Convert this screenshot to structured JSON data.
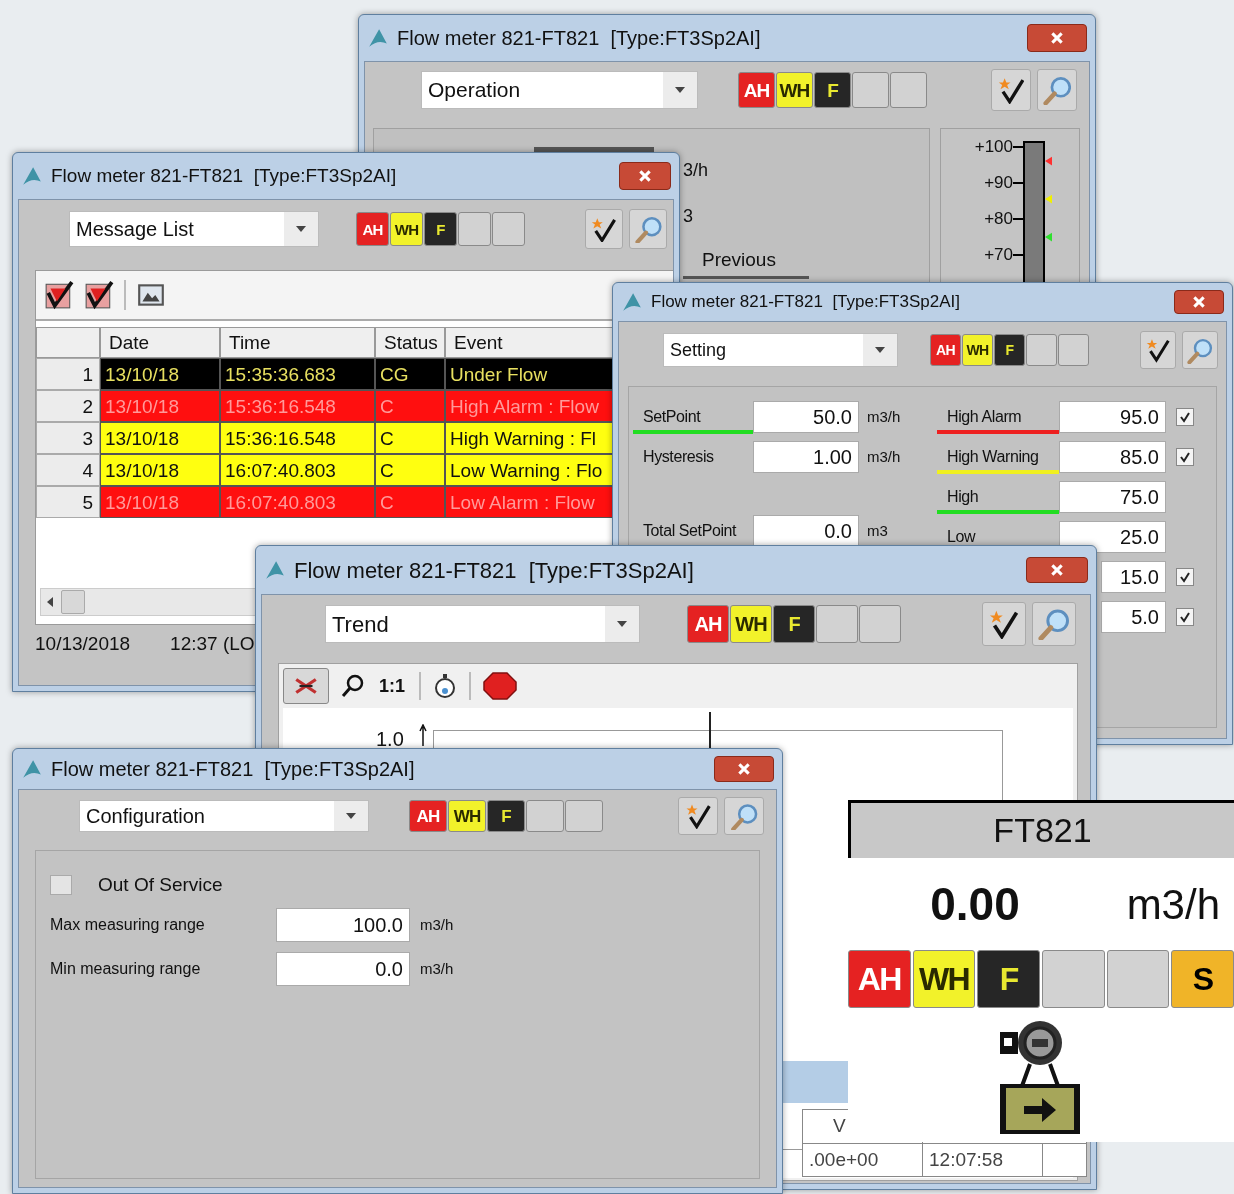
{
  "operation_window": {
    "title": "Flow meter 821-FT821  [Type:FT3Sp2AI]",
    "view": "Operation",
    "indicators": [
      {
        "kind": "alarm",
        "label": "AH"
      },
      {
        "kind": "warning",
        "label": "WH"
      },
      {
        "kind": "fault",
        "label": "F"
      },
      {
        "kind": "blank"
      },
      {
        "kind": "blank"
      }
    ],
    "fragments": [
      "3/h",
      "3"
    ],
    "tab": "Previous",
    "gauge": {
      "ticks": [
        "+100",
        "+90",
        "+80",
        "+70"
      ],
      "markers": [
        {
          "color": "#ff3030"
        },
        {
          "color": "#f0f000"
        },
        {
          "color": "#30e030"
        }
      ]
    }
  },
  "message_list_window": {
    "title": "Flow meter 821-FT821  [Type:FT3Sp2AI]",
    "view": "Message List",
    "indicators": [
      {
        "kind": "alarm",
        "label": "AH"
      },
      {
        "kind": "warning",
        "label": "WH"
      },
      {
        "kind": "fault",
        "label": "F"
      },
      {
        "kind": "blank"
      },
      {
        "kind": "blank"
      }
    ],
    "table": {
      "columns": [
        "Date",
        "Time",
        "Status",
        "Event"
      ],
      "rows": [
        {
          "number": "1",
          "kind": "normal",
          "cells": [
            "13/10/18",
            "15:35:36.683",
            "CG",
            "Under Flow"
          ]
        },
        {
          "number": "2",
          "kind": "alarm",
          "cells": [
            "13/10/18",
            "15:36:16.548",
            "C",
            "High Alarm : Flow"
          ]
        },
        {
          "number": "3",
          "kind": "warning",
          "cells": [
            "13/10/18",
            "15:36:16.548",
            "C",
            "High Warning : Fl"
          ]
        },
        {
          "number": "4",
          "kind": "warning",
          "cells": [
            "13/10/18",
            "16:07:40.803",
            "C",
            "Low Warning : Flo"
          ]
        },
        {
          "number": "5",
          "kind": "alarm",
          "cells": [
            "13/10/18",
            "16:07:40.803",
            "C",
            "Low Alarm : Flow"
          ]
        }
      ]
    },
    "status_bar": [
      "10/13/2018",
      "12:37 (LO"
    ]
  },
  "setting_window": {
    "title": "Flow meter 821-FT821  [Type:FT3Sp2AI]",
    "view": "Setting",
    "indicators": [
      {
        "kind": "alarm",
        "label": "AH"
      },
      {
        "kind": "warning",
        "label": "WH"
      },
      {
        "kind": "fault",
        "label": "F"
      },
      {
        "kind": "blank"
      },
      {
        "kind": "blank"
      }
    ],
    "setpoint_groups": [
      [
        {
          "label": "SetPoint",
          "value": "50.0",
          "unit": "m3/h",
          "color": "#22dd22"
        },
        {
          "label": "Hysteresis",
          "value": "1.00",
          "unit": "m3/h"
        }
      ],
      [
        {
          "label": "Total SetPoint",
          "value": "0.0",
          "unit": "m3"
        }
      ]
    ],
    "limits": [
      {
        "label": "High Alarm",
        "value": "95.0",
        "color": "#ee2020",
        "kind": "enable",
        "checked": true
      },
      {
        "label": "High Warning",
        "value": "85.0",
        "color": "#f0f020",
        "kind": "enable",
        "checked": true
      },
      {
        "label": "High",
        "value": "75.0",
        "color": "#22dd22",
        "kind": "plain"
      },
      {
        "label": "Low",
        "value": "25.0",
        "kind": "plain"
      },
      {
        "value": "15.0",
        "kind": "enable",
        "checked": true
      },
      {
        "value": "5.0",
        "kind": "enable",
        "checked": true
      }
    ]
  },
  "trend_window": {
    "title": "Flow meter 821-FT821  [Type:FT3Sp2AI]",
    "view": "Trend",
    "indicators": [
      {
        "kind": "alarm",
        "label": "AH"
      },
      {
        "kind": "warning",
        "label": "WH"
      },
      {
        "kind": "fault",
        "label": "F"
      },
      {
        "kind": "blank"
      },
      {
        "kind": "blank"
      }
    ],
    "zoom_reset": "1:1",
    "axis_max": "1.0",
    "table": {
      "columns": [
        "V"
      ],
      "rows": [
        [
          ".00e+00",
          "12:07:58"
        ]
      ]
    }
  },
  "configuration_window": {
    "title": "Flow meter 821-FT821  [Type:FT3Sp2AI]",
    "view": "Configuration",
    "indicators": [
      {
        "kind": "alarm",
        "label": "AH"
      },
      {
        "kind": "warning",
        "label": "WH"
      },
      {
        "kind": "fault",
        "label": "F"
      },
      {
        "kind": "blank"
      },
      {
        "kind": "blank"
      }
    ],
    "out_of_service": {
      "label": "Out Of Service",
      "checked": false
    },
    "ranges": [
      {
        "label": "Max measuring range",
        "value": "100.0",
        "unit": "m3/h"
      },
      {
        "label": "Min measuring range",
        "value": "0.0",
        "unit": "m3/h"
      }
    ]
  },
  "faceplate": {
    "tag": "FT821",
    "value": "0.00",
    "unit": "m3/h",
    "indicators": [
      {
        "kind": "alarm",
        "label": "AH"
      },
      {
        "kind": "warning",
        "label": "WH"
      },
      {
        "kind": "fault",
        "label": "F"
      },
      {
        "kind": "blank"
      },
      {
        "kind": "blank"
      },
      {
        "kind": "service",
        "label": "S"
      }
    ]
  }
}
